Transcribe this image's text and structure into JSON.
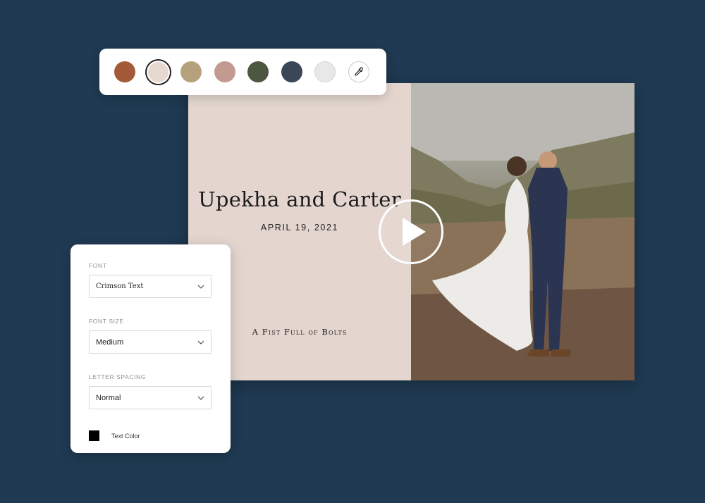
{
  "card": {
    "title": "Upekha and Carter",
    "date": "APRIL 19, 2021",
    "studio": "A Fist Full of Bolts"
  },
  "palette": {
    "swatches": [
      {
        "color": "#a35a38",
        "selected": false
      },
      {
        "color": "#e8d9d0",
        "selected": true
      },
      {
        "color": "#b5a27c",
        "selected": false
      },
      {
        "color": "#c49a90",
        "selected": false
      },
      {
        "color": "#4c5640",
        "selected": false
      },
      {
        "color": "#3b4658",
        "selected": false
      },
      {
        "color": "#e8e8e8",
        "selected": false
      }
    ],
    "tool_icon": "eyedropper-icon"
  },
  "panel": {
    "font": {
      "label": "FONT",
      "value": "Crimson Text"
    },
    "font_size": {
      "label": "FONT SIZE",
      "value": "Medium"
    },
    "letter_spacing": {
      "label": "LETTER SPACING",
      "value": "Normal"
    },
    "text_color": {
      "label": "Text Color",
      "color": "#000000"
    }
  },
  "colors": {
    "background": "#1f3a52",
    "card_left": "#e4d6cf"
  }
}
